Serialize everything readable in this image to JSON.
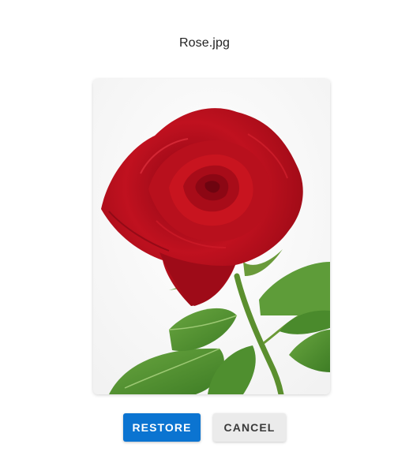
{
  "dialog": {
    "filename": "Rose.jpg",
    "preview_icon": "rose-photo",
    "buttons": {
      "restore_label": "RESTORE",
      "cancel_label": "CANCEL"
    },
    "colors": {
      "primary": "#0b74d1",
      "secondary": "#ebebeb",
      "rose": "#b5121b",
      "leaf": "#4f8f2f"
    }
  }
}
